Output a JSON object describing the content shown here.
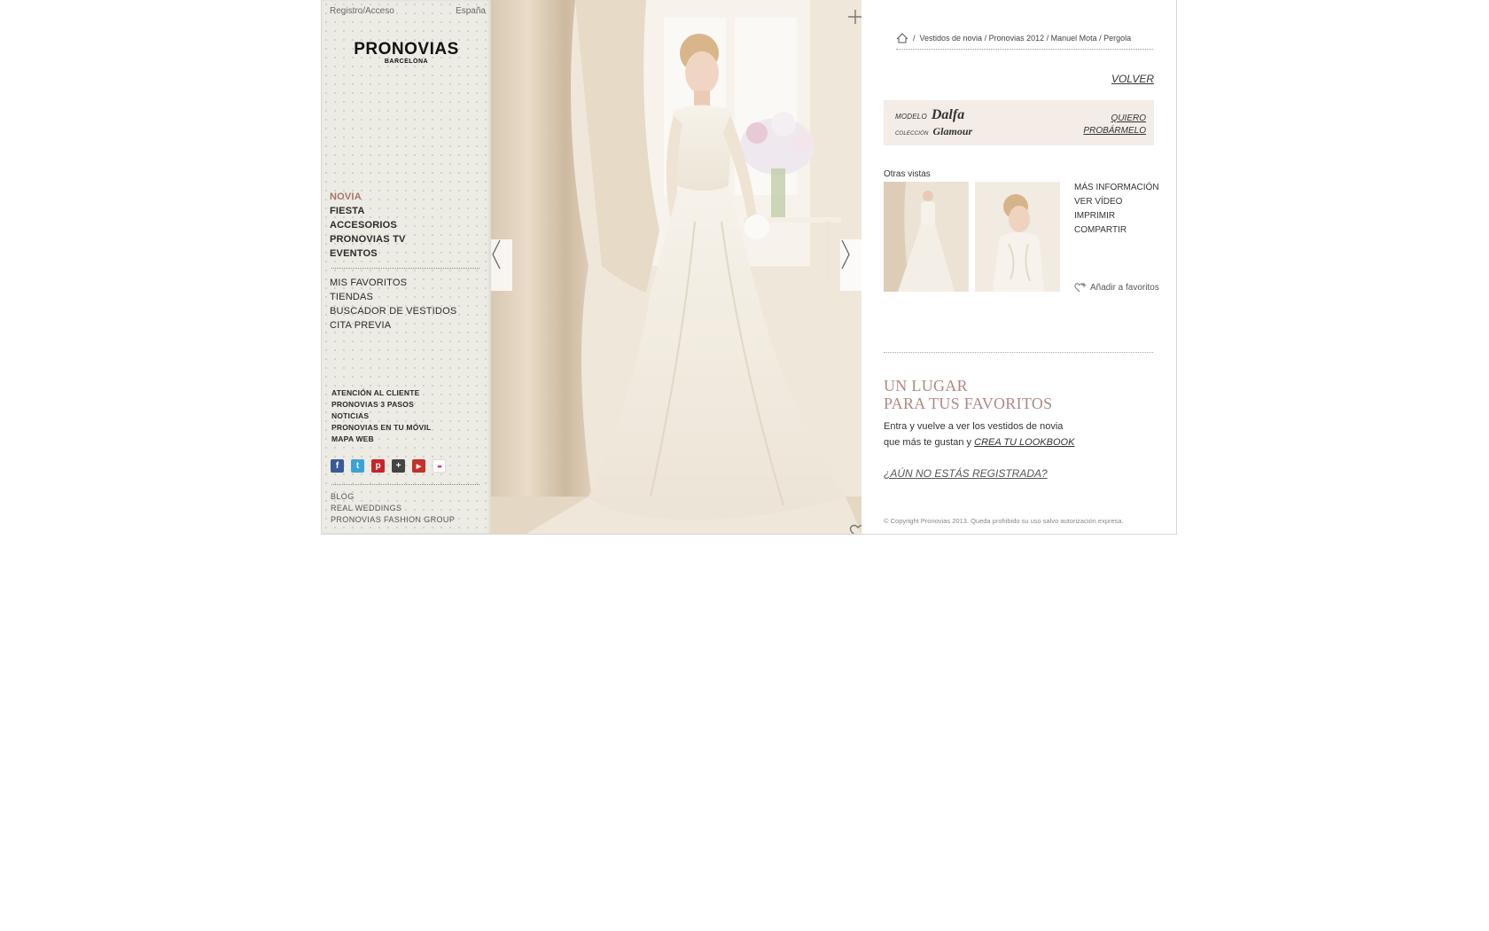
{
  "header": {
    "login": "Registro/Acceso",
    "country": "España"
  },
  "logo": {
    "name": "PRONOVIAS",
    "sub": "BARCELONA"
  },
  "main_menu": [
    "NOVIA",
    "FIESTA",
    "ACCESORIOS",
    "PRONOVIAS TV",
    "EVENTOS"
  ],
  "secondary_menu": [
    "MIS FAVORITOS",
    "TIENDAS",
    "BUSCADOR DE VESTIDOS",
    "CITA PREVIA"
  ],
  "small_menu": [
    "ATENCIÓN AL CLIENTE",
    "PRONOVIAS 3 PASOS",
    "NOTICIAS",
    "PRONOVIAS EN TU MÓVIL",
    "MAPA WEB"
  ],
  "social": [
    {
      "icon": "facebook-icon",
      "glyph": "f",
      "color": "#3b5998"
    },
    {
      "icon": "twitter-icon",
      "glyph": "t",
      "color": "#3aa3d6"
    },
    {
      "icon": "pinterest-icon",
      "glyph": "p",
      "color": "#c8232c"
    },
    {
      "icon": "delicious-icon",
      "glyph": "+",
      "color": "#444444"
    },
    {
      "icon": "youtube-icon",
      "glyph": "▶",
      "color": "#c4302b"
    },
    {
      "icon": "flickr-icon",
      "glyph": "••",
      "color": "#ffffff"
    }
  ],
  "bottom_menu": [
    "BLOG",
    "REAL WEDDINGS",
    "PRONOVIAS FASHION GROUP"
  ],
  "breadcrumb": {
    "separator": "/",
    "path": "Vestidos de novia / Pronovias 2012 / Manuel Mota / Pergola"
  },
  "volver": "VOLVER",
  "model": {
    "label": "MODELO",
    "name": "Dalfa",
    "collection_label": "COLECCIÓN",
    "collection": "Glamour",
    "cta_line1": "QUIERO",
    "cta_line2": "PROBÁRMELO"
  },
  "other_views": "Otras vistas",
  "actions": [
    "MÁS INFORMACIÓN",
    "VER VÍDEO",
    "IMPRIMIR",
    "COMPARTIR"
  ],
  "add_fav": "Añadir a favoritos",
  "favorites": {
    "title_line1": "UN LUGAR",
    "title_line2": "PARA TUS FAVORITOS",
    "text_line1": "Entra y vuelve a ver los vestidos de novia",
    "text_line2": "que más te gustan y",
    "link": "CREA TU LOOKBOOK",
    "register": "¿AÚN NO ESTÁS REGISTRADA?"
  },
  "copyright": "© Copyright Pronovias 2013. Queda prohibido su uso salvo autorización expresa.",
  "colors": {
    "accent": "#a8746c",
    "sidebar_bg": "#ecebe4",
    "model_box": "#f3ece7"
  }
}
